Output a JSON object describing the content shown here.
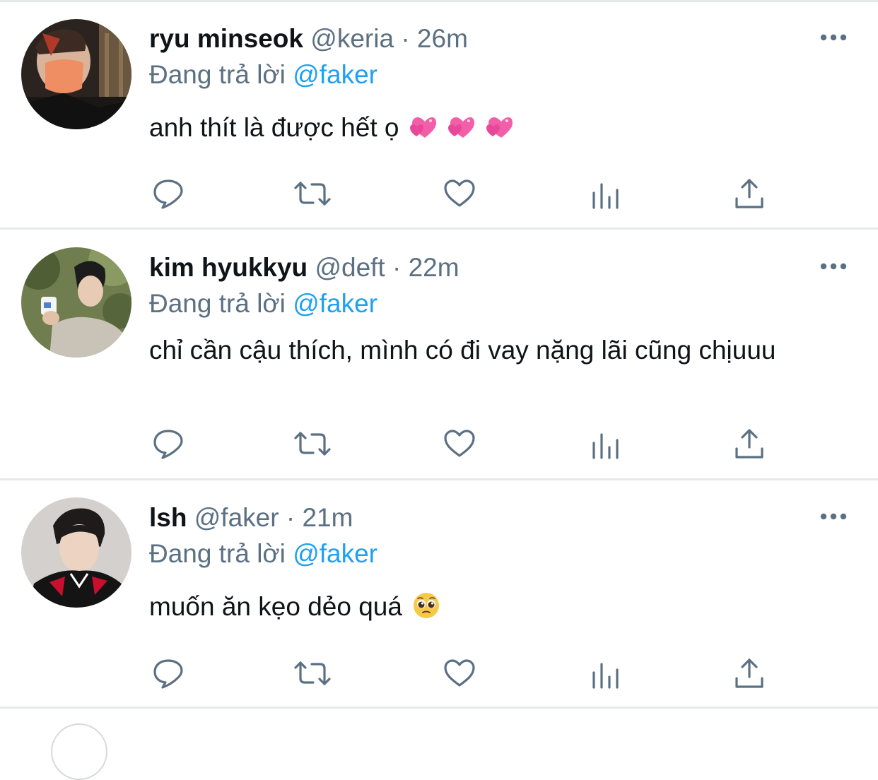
{
  "tweets": [
    {
      "name": "ryu minseok",
      "handle": "@keria",
      "separator": "·",
      "time": "26m",
      "reply_prefix": "Đang trả lời",
      "reply_to": "@faker",
      "text": "anh thít là được hết ọ",
      "emojis": [
        "sparkling-hearts-emoji",
        "sparkling-hearts-emoji",
        "sparkling-hearts-emoji"
      ]
    },
    {
      "name": "kim hyukkyu",
      "handle": "@deft",
      "separator": "·",
      "time": "22m",
      "reply_prefix": "Đang trả lời",
      "reply_to": "@faker",
      "text": "chỉ cần cậu thích, mình có đi vay nặng lãi cũng chịuuu",
      "emojis": []
    },
    {
      "name": "lsh",
      "handle": "@faker",
      "separator": "·",
      "time": "21m",
      "reply_prefix": "Đang trả lời",
      "reply_to": "@faker",
      "text": "muốn ăn kẹo dẻo quá",
      "emojis": [
        "pleading-face-emoji"
      ]
    }
  ],
  "action_icons": [
    "reply-icon",
    "retweet-icon",
    "like-icon",
    "analytics-icon",
    "share-icon"
  ],
  "colors": {
    "text_primary": "#0f1419",
    "text_secondary": "#5b7083",
    "accent": "#1da1f2",
    "divider": "#e6e9ec",
    "heart_emoji": "#f25fa8"
  }
}
